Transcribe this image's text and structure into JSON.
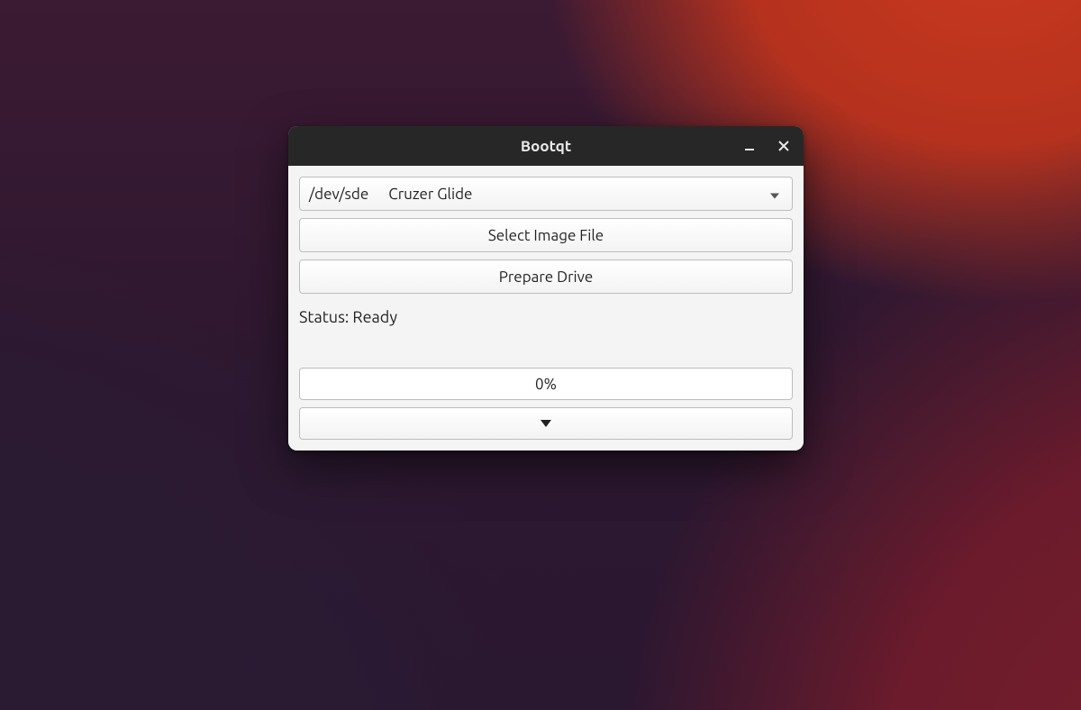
{
  "titlebar": {
    "title": "Bootqt"
  },
  "drive_select": {
    "device": "/dev/sde",
    "label": "Cruzer Glide"
  },
  "buttons": {
    "select_image": "Select Image File",
    "prepare_drive": "Prepare Drive"
  },
  "status": {
    "text": "Status: Ready"
  },
  "progress": {
    "text": "0%"
  }
}
